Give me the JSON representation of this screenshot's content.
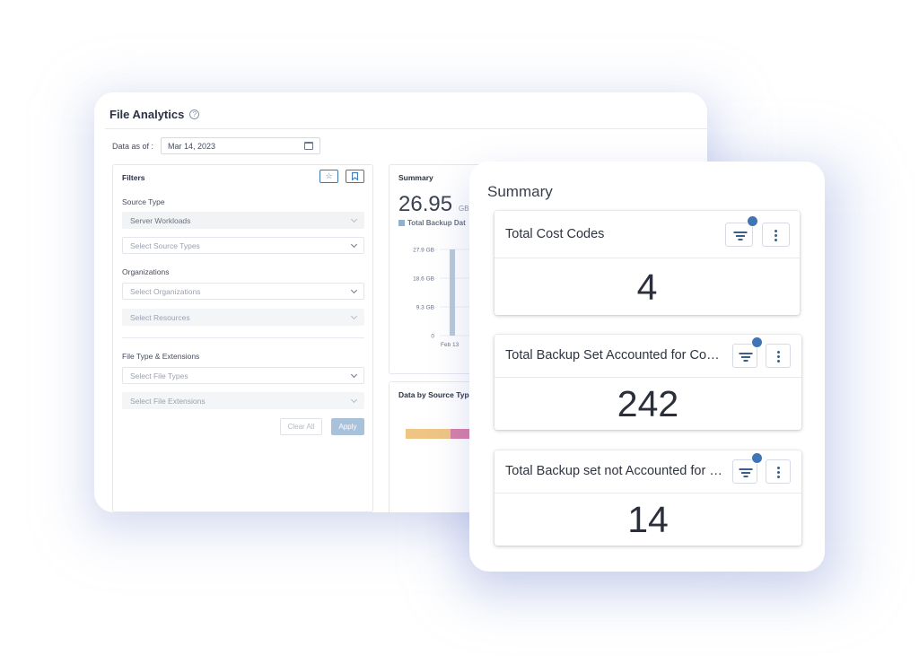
{
  "analytics": {
    "title": "File Analytics",
    "date_label": "Data as of :",
    "date_value": "Mar 14, 2023",
    "filters": {
      "title": "Filters",
      "source_type_label": "Source Type",
      "source_type_value": "Server Workloads",
      "source_types_placeholder": "Select Source Types",
      "organizations_label": "Organizations",
      "organizations_placeholder": "Select Organizations",
      "resources_placeholder": "Select Resources",
      "file_type_label": "File Type & Extensions",
      "file_types_placeholder": "Select File Types",
      "file_extensions_placeholder": "Select File Extensions",
      "clear_label": "Clear All",
      "apply_label": "Apply"
    },
    "summary": {
      "title": "Summary",
      "value": "26.95",
      "unit": "GB",
      "legend": "Total Backup Dat"
    },
    "source": {
      "title": "Data by Source Type"
    }
  },
  "chart_data": {
    "type": "bar",
    "categories": [
      "Feb 13"
    ],
    "series": [
      {
        "name": "Total Backup Data",
        "values": [
          27.9
        ]
      }
    ],
    "yticks": [
      "27.9 GB",
      "18.6 GB",
      "9.3 GB",
      "0"
    ],
    "ylim": [
      0,
      27.9
    ],
    "xlabel": "",
    "ylabel": "",
    "grid": true,
    "color": "#b8c9da"
  },
  "source_bar": {
    "segments": [
      {
        "color": "#eec584",
        "share": 0.45
      },
      {
        "color": "#d67fa8",
        "share": 0.19
      },
      {
        "color": "#d8863f",
        "share": 0.36
      }
    ]
  },
  "summary_card": {
    "title": "Summary",
    "metrics": [
      {
        "label": "Total Cost Codes",
        "value": "4"
      },
      {
        "label": "Total Backup Set Accounted for Cost Codes",
        "value": "242"
      },
      {
        "label": "Total Backup set not Accounted for Cost Codes",
        "value": "14"
      }
    ]
  },
  "colors": {
    "accent": "#3f74b5",
    "apply_button": "#a9c2dc"
  }
}
